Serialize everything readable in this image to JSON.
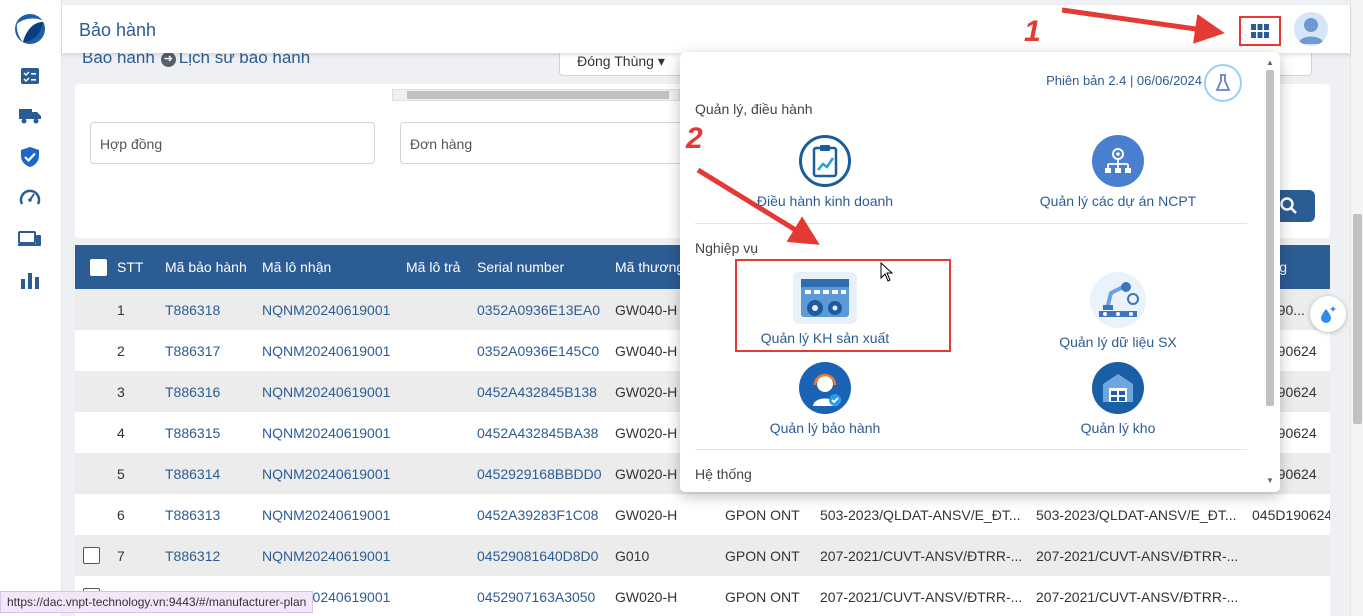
{
  "header": {
    "title": "Bảo hành"
  },
  "breadcrumb": {
    "item1": "Bảo hành",
    "item2": "Lịch sử bảo hành",
    "separator": "➜"
  },
  "toolbar": {
    "dropdown_label": "Đóng Thùng"
  },
  "filters": {
    "contract_placeholder": "Hợp đồng",
    "order_placeholder": "Đơn hàng"
  },
  "table": {
    "headers": [
      "STT",
      "Mã bảo hành",
      "Mã lô nhận",
      "Mã lô trả",
      "Serial number",
      "Mã thương",
      "",
      "",
      "",
      "thùng"
    ],
    "rows": [
      {
        "stt": "1",
        "ma_bh": "T886318",
        "ma_lo": "NQNM20240619001",
        "ma_lo_tra": "",
        "serial": "0352A0936E13EA0",
        "ma_tm": "GW040-H",
        "type": "",
        "c1": "",
        "c2": "",
        "thung": "5D190..."
      },
      {
        "stt": "2",
        "ma_bh": "T886317",
        "ma_lo": "NQNM20240619001",
        "ma_lo_tra": "",
        "serial": "0352A0936E145C0",
        "ma_tm": "GW040-H",
        "type": "",
        "c1": "",
        "c2": "",
        "thung": "5D190624"
      },
      {
        "stt": "3",
        "ma_bh": "T886316",
        "ma_lo": "NQNM20240619001",
        "ma_lo_tra": "",
        "serial": "0452A432845B138",
        "ma_tm": "GW020-H",
        "type": "",
        "c1": "",
        "c2": "",
        "thung": "5D190624"
      },
      {
        "stt": "4",
        "ma_bh": "T886315",
        "ma_lo": "NQNM20240619001",
        "ma_lo_tra": "",
        "serial": "0452A432845BA38",
        "ma_tm": "GW020-H",
        "type": "",
        "c1": "",
        "c2": "",
        "thung": "5D190624"
      },
      {
        "stt": "5",
        "ma_bh": "T886314",
        "ma_lo": "NQNM20240619001",
        "ma_lo_tra": "",
        "serial": "0452929168BBDD0",
        "ma_tm": "GW020-H",
        "type": "",
        "c1": "",
        "c2": "",
        "thung": "5D190624"
      },
      {
        "stt": "6",
        "ma_bh": "T886313",
        "ma_lo": "NQNM20240619001",
        "ma_lo_tra": "",
        "serial": "0452A39283F1C08",
        "ma_tm": "GW020-H",
        "type": "GPON ONT",
        "c1": "503-2023/QLDAT-ANSV/E_ĐT...",
        "c2": "503-2023/QLDAT-ANSV/E_ĐT...",
        "thung": "045D190624"
      },
      {
        "stt": "7",
        "ma_bh": "T886312",
        "ma_lo": "NQNM20240619001",
        "ma_lo_tra": "",
        "serial": "04529081640D8D0",
        "ma_tm": "G010",
        "type": "GPON ONT",
        "c1": "207-2021/CUVT-ANSV/ĐTRR-...",
        "c2": "207-2021/CUVT-ANSV/ĐTRR-...",
        "thung": ""
      },
      {
        "stt": "8",
        "ma_bh": "",
        "ma_lo": "NQNM20240619001",
        "ma_lo_tra": "",
        "serial": "0452907163A3050",
        "ma_tm": "GW020-H",
        "type": "GPON ONT",
        "c1": "207-2021/CUVT-ANSV/ĐTRR-...",
        "c2": "207-2021/CUVT-ANSV/ĐTRR-...",
        "thung": ""
      }
    ]
  },
  "app_menu": {
    "version": "Phiên bản 2.4 | 06/06/2024",
    "sections": [
      {
        "title": "Quản lý, điều hành",
        "apps": [
          {
            "label": "Điều hành kinh doanh",
            "icon": "clipboard-chart-icon"
          },
          {
            "label": "Quản lý các dự án NCPT",
            "icon": "gear-network-icon"
          }
        ]
      },
      {
        "title": "Nghiệp vụ",
        "apps": [
          {
            "label": "Quản lý KH sản xuất",
            "icon": "calendar-gears-icon"
          },
          {
            "label": "Quản lý dữ liệu SX",
            "icon": "factory-robot-icon"
          },
          {
            "label": "Quản lý bảo hành",
            "icon": "support-agent-icon"
          },
          {
            "label": "Quản lý kho",
            "icon": "warehouse-icon"
          }
        ]
      },
      {
        "title": "Hệ thống",
        "apps": []
      }
    ]
  },
  "annotations": {
    "step1": "1",
    "step2": "2"
  },
  "status_url": "https://dac.vnpt-technology.vn:9443/#/manufacturer-plan",
  "colors": {
    "primary": "#2c5c94",
    "annotation": "#e53935"
  }
}
